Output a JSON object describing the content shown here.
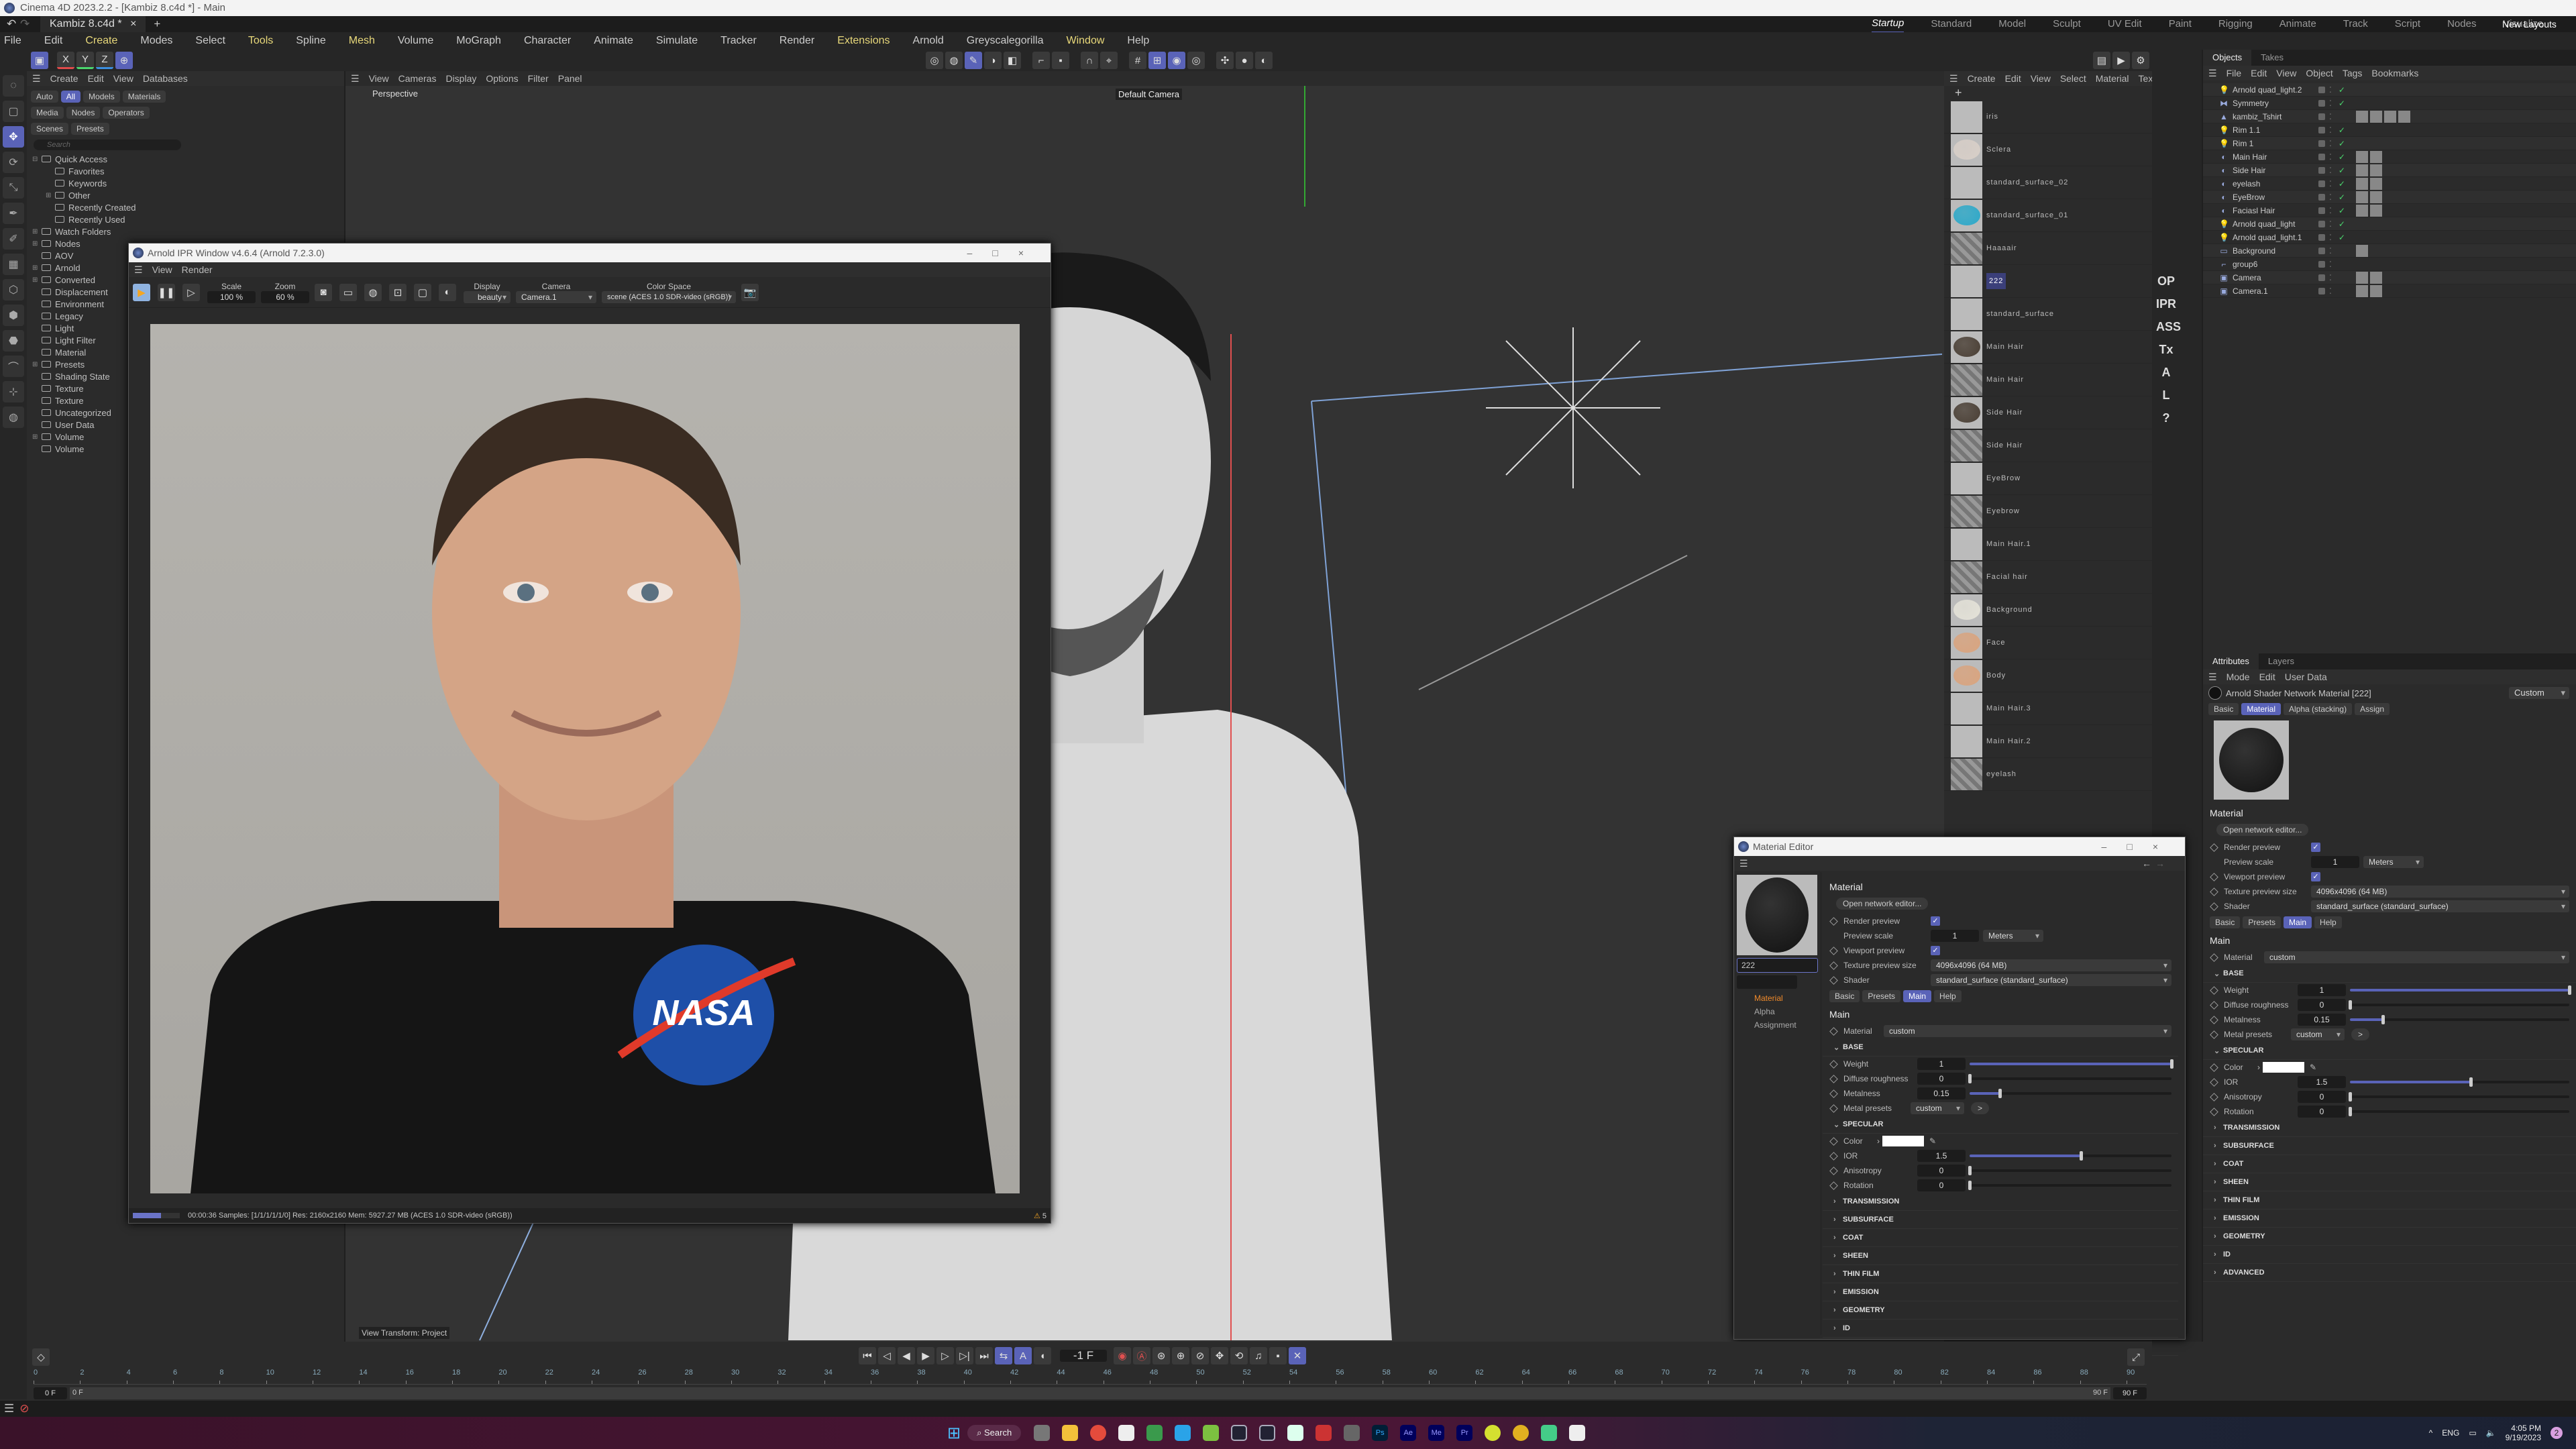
{
  "app": {
    "title": "Cinema 4D 2023.2.2 - [Kambiz 8.c4d *] - Main",
    "doc_tab": "Kambiz 8.c4d *",
    "layouts": [
      "Startup",
      "Standard",
      "Model",
      "Sculpt",
      "UV Edit",
      "Paint",
      "Rigging",
      "Animate",
      "Track",
      "Script",
      "Nodes",
      "Visualize"
    ],
    "active_layout": "Startup",
    "new_layouts": "New Layouts"
  },
  "menu": [
    {
      "l": "File"
    },
    {
      "l": "Edit"
    },
    {
      "l": "Create",
      "hl": true
    },
    {
      "l": "Modes"
    },
    {
      "l": "Select"
    },
    {
      "l": "Tools",
      "hl": true
    },
    {
      "l": "Spline"
    },
    {
      "l": "Mesh",
      "hl": true
    },
    {
      "l": "Volume"
    },
    {
      "l": "MoGraph"
    },
    {
      "l": "Character"
    },
    {
      "l": "Animate"
    },
    {
      "l": "Simulate"
    },
    {
      "l": "Tracker"
    },
    {
      "l": "Render"
    },
    {
      "l": "Extensions",
      "hl": true
    },
    {
      "l": "Arnold"
    },
    {
      "l": "Greyscalegorilla"
    },
    {
      "l": "Window",
      "hl": true
    },
    {
      "l": "Help"
    }
  ],
  "toolbar": {
    "axes": [
      "X",
      "Y",
      "Z"
    ]
  },
  "content_browser": {
    "menu": [
      "Create",
      "Edit",
      "View",
      "Databases"
    ],
    "tabs": [
      "Auto",
      "All",
      "Models",
      "Materials",
      "Media",
      "Nodes",
      "Operators",
      "Scenes",
      "Presets"
    ],
    "active_tab": "All",
    "search_placeholder": "Search",
    "tree": [
      {
        "l": "Quick Access",
        "lv": 0,
        "ex": "⊟"
      },
      {
        "l": "Favorites",
        "lv": 1
      },
      {
        "l": "Keywords",
        "lv": 1
      },
      {
        "l": "Other",
        "lv": 1,
        "ex": "⊞"
      },
      {
        "l": "Recently Created",
        "lv": 1
      },
      {
        "l": "Recently Used",
        "lv": 1
      },
      {
        "l": "Watch Folders",
        "lv": 0,
        "ex": "⊞"
      },
      {
        "l": "Nodes",
        "lv": 0,
        "ex": "⊞"
      },
      {
        "l": "AOV",
        "lv": 0
      },
      {
        "l": "Arnold",
        "lv": 0,
        "ex": "⊞"
      },
      {
        "l": "Converted",
        "lv": 0,
        "ex": "⊞"
      },
      {
        "l": "Displacement",
        "lv": 0
      },
      {
        "l": "Environment",
        "lv": 0
      },
      {
        "l": "Legacy",
        "lv": 0
      },
      {
        "l": "Light",
        "lv": 0
      },
      {
        "l": "Light Filter",
        "lv": 0
      },
      {
        "l": "Material",
        "lv": 0
      },
      {
        "l": "Presets",
        "lv": 0,
        "ex": "⊞"
      },
      {
        "l": "Shading State",
        "lv": 0
      },
      {
        "l": "Texture",
        "lv": 0
      },
      {
        "l": "Texture",
        "lv": 0
      },
      {
        "l": "Uncategorized",
        "lv": 0
      },
      {
        "l": "User Data",
        "lv": 0
      },
      {
        "l": "Volume",
        "lv": 0,
        "ex": "⊞"
      },
      {
        "l": "Volume",
        "lv": 0
      }
    ]
  },
  "ipr": {
    "title": "Arnold IPR Window v4.6.4 (Arnold 7.2.3.0)",
    "menu": [
      "View",
      "Render"
    ],
    "scale_label": "Scale",
    "scale": "100 %",
    "zoom_label": "Zoom",
    "zoom": "60 %",
    "display_label": "Display",
    "display": "beauty",
    "camera_label": "Camera",
    "camera": "Camera.1",
    "colorspace_label": "Color Space",
    "colorspace": "scene (ACES 1.0 SDR-video (sRGB))",
    "status": "00:00:36  Samples: [1/1/1/1/1/0]  Res: 2160x2160  Mem: 5927.27 MB  (ACES 1.0 SDR-video (sRGB))",
    "warnings": "5",
    "progress": 0.6,
    "logo_text": "NASA"
  },
  "viewport": {
    "menu": [
      "View",
      "Cameras",
      "Display",
      "Options",
      "Filter",
      "Panel"
    ],
    "label": "Perspective",
    "camera": "Default Camera",
    "view_transform": "View Transform: Project"
  },
  "material_manager": {
    "menu": [
      "Create",
      "Edit",
      "View",
      "Select",
      "Material",
      "Texture"
    ],
    "items": [
      {
        "n": "iris",
        "c": "#666"
      },
      {
        "n": "Sclera",
        "c": "#d8cfc8"
      },
      {
        "n": "standard_surface_02",
        "c": "#000"
      },
      {
        "n": "standard_surface_01",
        "c": "#2ea9c9"
      },
      {
        "n": "Haaaair",
        "c": "stripe"
      },
      {
        "n": "222",
        "c": "#222",
        "sel": true
      },
      {
        "n": "standard_surface",
        "c": "#333"
      },
      {
        "n": "Main Hair",
        "c": "#4a3f35"
      },
      {
        "n": "Main Hair",
        "c": "stripe"
      },
      {
        "n": "Side Hair",
        "c": "#4a3f35"
      },
      {
        "n": "Side Hair",
        "c": "stripe"
      },
      {
        "n": "EyeBrow",
        "c": "#555"
      },
      {
        "n": "Eyebrow",
        "c": "stripe"
      },
      {
        "n": "Main Hair.1",
        "c": "#777"
      },
      {
        "n": "Facial hair",
        "c": "stripe"
      },
      {
        "n": "Background",
        "c": "#e4e2d8"
      },
      {
        "n": "Face",
        "c": "#d9a47f"
      },
      {
        "n": "Body",
        "c": "#d9a47f"
      },
      {
        "n": "Main Hair.3",
        "c": "#111"
      },
      {
        "n": "Main Hair.2",
        "c": "#111"
      },
      {
        "n": "eyelash",
        "c": "stripe"
      }
    ]
  },
  "palette": [
    "OP",
    "IPR",
    "ASS",
    "Tx",
    "A",
    "L",
    "?"
  ],
  "objects": {
    "tabs": [
      "Objects",
      "Takes"
    ],
    "menu": [
      "File",
      "Edit",
      "View",
      "Object",
      "Tags",
      "Bookmarks"
    ],
    "items": [
      {
        "n": "Arnold quad_light.2",
        "i": "💡",
        "chk": true
      },
      {
        "n": "Symmetry",
        "i": "⧓",
        "chk": true
      },
      {
        "n": "kambiz_Tshirt",
        "i": "▲",
        "chk": false,
        "tags": 4
      },
      {
        "n": "Rim 1.1",
        "i": "💡",
        "chk": true
      },
      {
        "n": "Rim 1",
        "i": "💡",
        "chk": true
      },
      {
        "n": "Main Hair",
        "i": "◐",
        "chk": true,
        "tags": 2
      },
      {
        "n": "Side Hair",
        "i": "◐",
        "chk": true,
        "tags": 2
      },
      {
        "n": "eyelash",
        "i": "◐",
        "chk": true,
        "tags": 2
      },
      {
        "n": "EyeBrow",
        "i": "◐",
        "chk": true,
        "tags": 2
      },
      {
        "n": "Faciasl Hair",
        "i": "◐",
        "chk": true,
        "tags": 2
      },
      {
        "n": "Arnold quad_light",
        "i": "💡",
        "chk": true
      },
      {
        "n": "Arnold quad_light.1",
        "i": "💡",
        "chk": true
      },
      {
        "n": "Background",
        "i": "▭",
        "chk": false,
        "tags": 1
      },
      {
        "n": "group6",
        "i": "⌐",
        "chk": false
      },
      {
        "n": "Camera",
        "i": "▣",
        "chk": false,
        "tags": 2
      },
      {
        "n": "Camera.1",
        "i": "▣",
        "chk": false,
        "tags": 2
      }
    ]
  },
  "attributes": {
    "tabs": [
      "Attributes",
      "Layers"
    ],
    "menu": [
      "Mode",
      "Edit",
      "User Data"
    ],
    "title": "Arnold Shader Network Material [222]",
    "mode": "Custom",
    "tabs2": [
      "Basic",
      "Material",
      "Alpha (stacking)",
      "Assign"
    ],
    "active_tab2": "Material"
  },
  "mat": {
    "section": "Material",
    "open_editor": "Open network editor...",
    "render_preview": "Render preview",
    "preview_scale": "Preview scale",
    "preview_scale_value": "1",
    "units": "Meters",
    "viewport_preview": "Viewport preview",
    "tex_size_label": "Texture preview size",
    "tex_size": "4096x4096 (64 MB)",
    "shader_label": "Shader",
    "shader": "standard_surface (standard_surface)",
    "subtabs": [
      "Basic",
      "Presets",
      "Main",
      "Help"
    ],
    "active_subtab": "Main",
    "main": "Main",
    "material_label": "Material",
    "material": "custom",
    "base": "BASE",
    "weight": {
      "l": "Weight",
      "v": "1",
      "f": 1
    },
    "diffuse": {
      "l": "Diffuse roughness",
      "v": "0",
      "f": 0
    },
    "metal": {
      "l": "Metalness",
      "v": "0.15",
      "f": 0.15
    },
    "metal_presets": "Metal presets",
    "metal_presets_v": "custom",
    "specular": "SPECULAR",
    "color": "Color",
    "spec_color": "#ffffff",
    "ior": {
      "l": "IOR",
      "v": "1.5",
      "f": 0.55
    },
    "aniso": {
      "l": "Anisotropy",
      "v": "0",
      "f": 0
    },
    "rot": {
      "l": "Rotation",
      "v": "0",
      "f": 0
    },
    "collapsed": [
      "TRANSMISSION",
      "SUBSURFACE",
      "COAT",
      "SHEEN",
      "THIN FILM",
      "EMISSION",
      "GEOMETRY",
      "ID",
      "ADVANCED"
    ]
  },
  "material_editor": {
    "title": "Material Editor",
    "name": "222",
    "nav": [
      "Material",
      "Alpha",
      "Assignment"
    ],
    "active_nav": "Material"
  },
  "timeline": {
    "ticks": [
      0,
      2,
      4,
      6,
      8,
      10,
      12,
      14,
      16,
      18,
      20,
      22,
      24,
      26,
      28,
      30,
      32,
      34,
      36,
      38,
      40,
      42,
      44,
      46,
      48,
      50,
      52,
      54,
      56,
      58,
      60,
      62,
      64,
      66,
      68,
      70,
      72,
      74,
      76,
      78,
      80,
      82,
      84,
      86,
      88,
      90
    ],
    "current": "-1 F",
    "start": "0 F",
    "range_start": "0 F",
    "range_end": "90 F",
    "end": "90 F"
  },
  "taskbar": {
    "search": "Search",
    "lang": "ENG",
    "time": "4:05 PM",
    "date": "9/19/2023",
    "notif": "2"
  },
  "colors": {
    "accent": "#5a63b8",
    "check": "#4ad66d",
    "x_axis": "#e04b4b",
    "y_axis": "#4bd66d",
    "z_axis": "#3b8ee0"
  }
}
